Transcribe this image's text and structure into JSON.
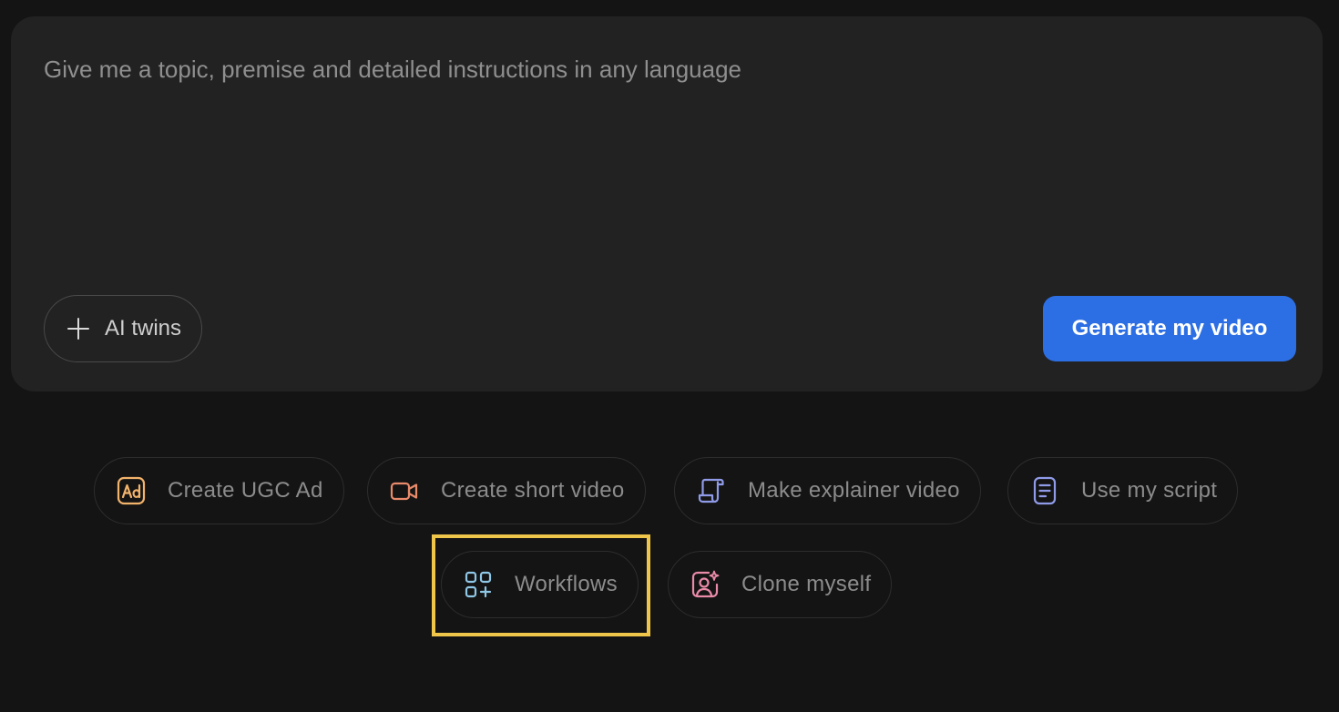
{
  "prompt": {
    "placeholder": "Give me a topic, premise and detailed instructions in any language",
    "value": ""
  },
  "ai_twins": {
    "label": "AI twins",
    "icon": "plus-icon"
  },
  "generate_button": {
    "label": "Generate my video",
    "color": "#2c6fe4"
  },
  "quick_actions": [
    {
      "label": "Create UGC Ad",
      "icon": "ad-icon",
      "color": "#f2b36b"
    },
    {
      "label": "Create short video",
      "icon": "video-camera-icon",
      "color": "#e98a6b"
    },
    {
      "label": "Make explainer video",
      "icon": "scroll-icon",
      "color": "#8f9be8"
    },
    {
      "label": "Use my script",
      "icon": "document-icon",
      "color": "#8f9be8"
    },
    {
      "label": "Workflows",
      "icon": "grid-plus-icon",
      "color": "#8fc7e6"
    },
    {
      "label": "Clone myself",
      "icon": "person-sparkle-icon",
      "color": "#e98aa8"
    }
  ],
  "highlight_color": "#f0c64a"
}
